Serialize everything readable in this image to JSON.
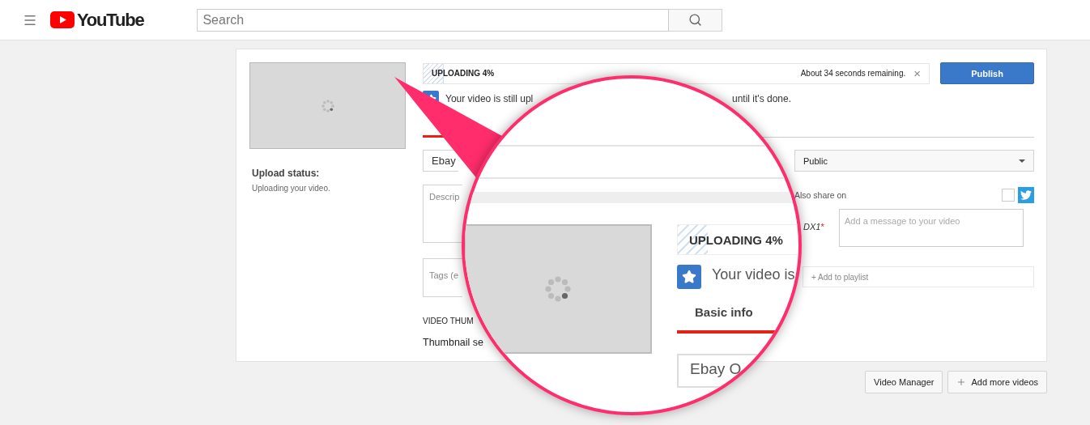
{
  "header": {
    "logo_text": "YouTube",
    "search_placeholder": "Search"
  },
  "upload_status": {
    "label": "Upload status:",
    "text": "Uploading your video."
  },
  "progress": {
    "label": "UPLOADING 4%",
    "level": 0.04,
    "remaining": "About 34 seconds remaining.",
    "close": "×"
  },
  "publish_button": "Publish",
  "notice": {
    "before": "Your video is still upl",
    "after": "until it's done."
  },
  "tabs": [
    {
      "label": "Basic info",
      "selected": true
    }
  ],
  "form": {
    "title_value": "Ebay",
    "description_placeholder": "Descrip",
    "tags_placeholder": "Tags (e",
    "privacy": "Public",
    "share_label": "Also share on",
    "share_checked": false,
    "account": "DX1",
    "required_mark": "*",
    "message_placeholder": "Add a message to your video",
    "playlist": "+ Add to playlist",
    "thumbnails_heading": "VIDEO THUM",
    "thumbnails_text": "Thumbnail se"
  },
  "footer_buttons": [
    {
      "kind": "plain",
      "label": "Video Manager"
    },
    {
      "kind": "add",
      "label": "Add more videos"
    }
  ],
  "magnifier": {
    "progress_label": "UPLOADING 4%",
    "notice": "Your video is",
    "title_value": "Ebay O"
  }
}
